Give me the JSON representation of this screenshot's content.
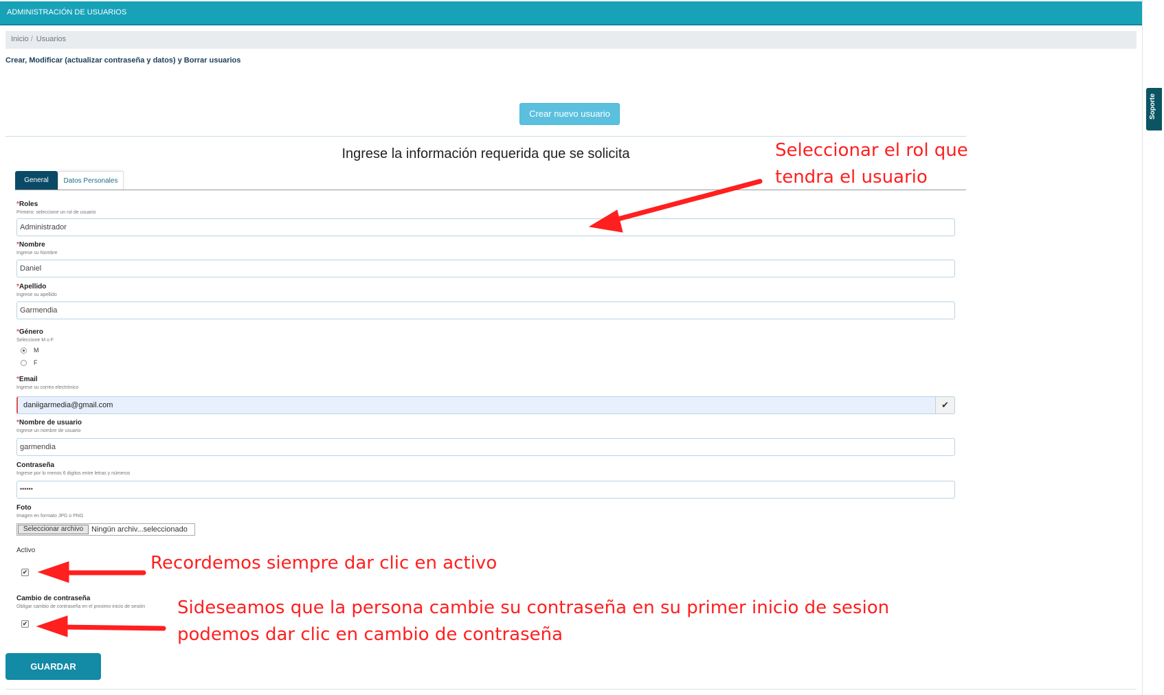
{
  "header": {
    "title": "ADMINISTRACIÓN DE USUARIOS"
  },
  "support_tab": {
    "label": "Soporte"
  },
  "breadcrumb": {
    "items": [
      "Inicio",
      "/",
      "Usuarios"
    ]
  },
  "page": {
    "subtitle": "Crear, Modificar (actualizar contraseña y datos) y Borrar usuarios"
  },
  "create_button": {
    "label": "Crear nuevo usuario"
  },
  "form": {
    "title": "Ingrese la información requerida que se solicita",
    "tabs": [
      {
        "label": "General",
        "active": true
      },
      {
        "label": "Datos Personales",
        "active": false
      }
    ],
    "required_mark": "*",
    "roles": {
      "label": "Roles",
      "hint": "Primero: seleccione un rol de usuario",
      "value": "Administrador"
    },
    "nombre": {
      "label": "Nombre",
      "hint": "Ingrese su Nombre",
      "value": "Daniel"
    },
    "apellido": {
      "label": "Apellido",
      "hint": "Ingrese su apellido",
      "value": "Garmendia"
    },
    "genero": {
      "label": "Género",
      "hint": "Seleccione M o F",
      "options": [
        "M",
        "F"
      ],
      "selected": "M"
    },
    "email": {
      "label": "Email",
      "hint": "Ingrese su correo electrónico",
      "value": "daniigarmedia@gmail.com",
      "status_icon": "checkmark-icon",
      "status_glyph": "✔"
    },
    "usuario": {
      "label": "Nombre de usuario",
      "hint": "Ingrese un nombre de usuario",
      "value": "garmendia"
    },
    "contrasena": {
      "label": "Contraseña",
      "hint": "Ingrese por lo menos 6 digitos entre letras y números",
      "value": "••••••"
    },
    "foto": {
      "label": "Foto",
      "hint": "Imagen en formato JPG o PNG",
      "button": "Seleccionar archivo",
      "status": "Ningún archiv...seleccionado"
    },
    "activo": {
      "label": "Activo",
      "checked": true,
      "glyph": "✔"
    },
    "cambio": {
      "label": "Cambio de contraseña",
      "hint": "Obligar cambio de contraseña en el proximo inicio de sesión",
      "checked": true,
      "glyph": "✔"
    },
    "save_button": {
      "label": "GUARDAR"
    }
  },
  "annotations": {
    "rol_line1": "Seleccionar el rol que",
    "rol_line2": "tendra el usuario",
    "activo": "Recordemos siempre dar clic en activo",
    "cambio_line1": "Sideseamos que la persona cambie su contraseña en su primer inicio de sesion",
    "cambio_line2": "podemos dar clic en cambio de contraseña",
    "color": "#ff1f1f"
  },
  "colors": {
    "header": "#17a2b8",
    "tab_active": "#0b4a66",
    "save_button": "#138aa6",
    "create_button": "#5bc0de",
    "required": "#d9534f"
  }
}
